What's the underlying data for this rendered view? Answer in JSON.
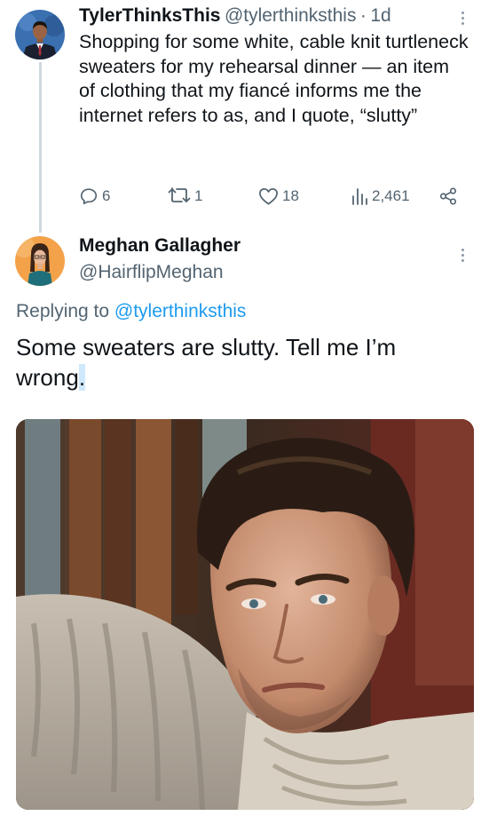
{
  "tweet": {
    "author_name": "TylerThinksThis",
    "author_handle": "@tylerthinksthis",
    "separator": "·",
    "time": "1d",
    "text": "Shopping for some white, cable knit turtleneck sweaters for my rehearsal dinner — an item of clothing that my fiancé informs me the internet refers to as, and I quote, “slutty”",
    "replies": "6",
    "retweets": "1",
    "likes": "18",
    "views": "2,461"
  },
  "reply": {
    "author_name": "Meghan Gallagher",
    "author_handle": "@HairflipMeghan",
    "replying_prefix": "Replying to ",
    "replying_to": "@tylerthinksthis",
    "text_main": "Some sweaters are slutty. Tell me I’m wrong",
    "text_highlight": "."
  },
  "icons": {
    "reply": "reply-icon",
    "retweet": "retweet-icon",
    "like": "heart-icon",
    "views": "bar-chart-icon",
    "share": "share-icon",
    "more": "more-icon"
  },
  "colors": {
    "link": "#1d9bf0",
    "muted": "#536471",
    "thread_line": "#cfd9de",
    "selection": "#cfe8fc"
  }
}
